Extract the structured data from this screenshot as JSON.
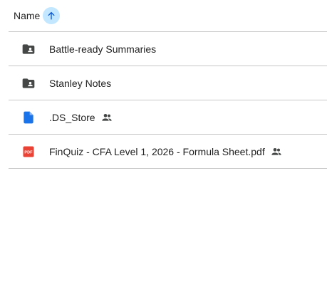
{
  "header": {
    "label": "Name",
    "sort_icon": "arrow-up-icon",
    "accent": "#c2e7ff",
    "arrow_color": "#0b57d0"
  },
  "files": [
    {
      "name": "Battle-ready Summaries",
      "type": "shared-folder",
      "shared": false,
      "icon_color": "#444746"
    },
    {
      "name": "Stanley Notes",
      "type": "shared-folder",
      "shared": false,
      "icon_color": "#444746"
    },
    {
      "name": ".DS_Store",
      "type": "file",
      "shared": true,
      "icon_color": "#1a73e8"
    },
    {
      "name": "FinQuiz - CFA Level 1, 2026 - Formula Sheet.pdf",
      "type": "pdf",
      "shared": true,
      "icon_color": "#ea4335"
    }
  ],
  "icons": {
    "shared": "people-icon"
  }
}
